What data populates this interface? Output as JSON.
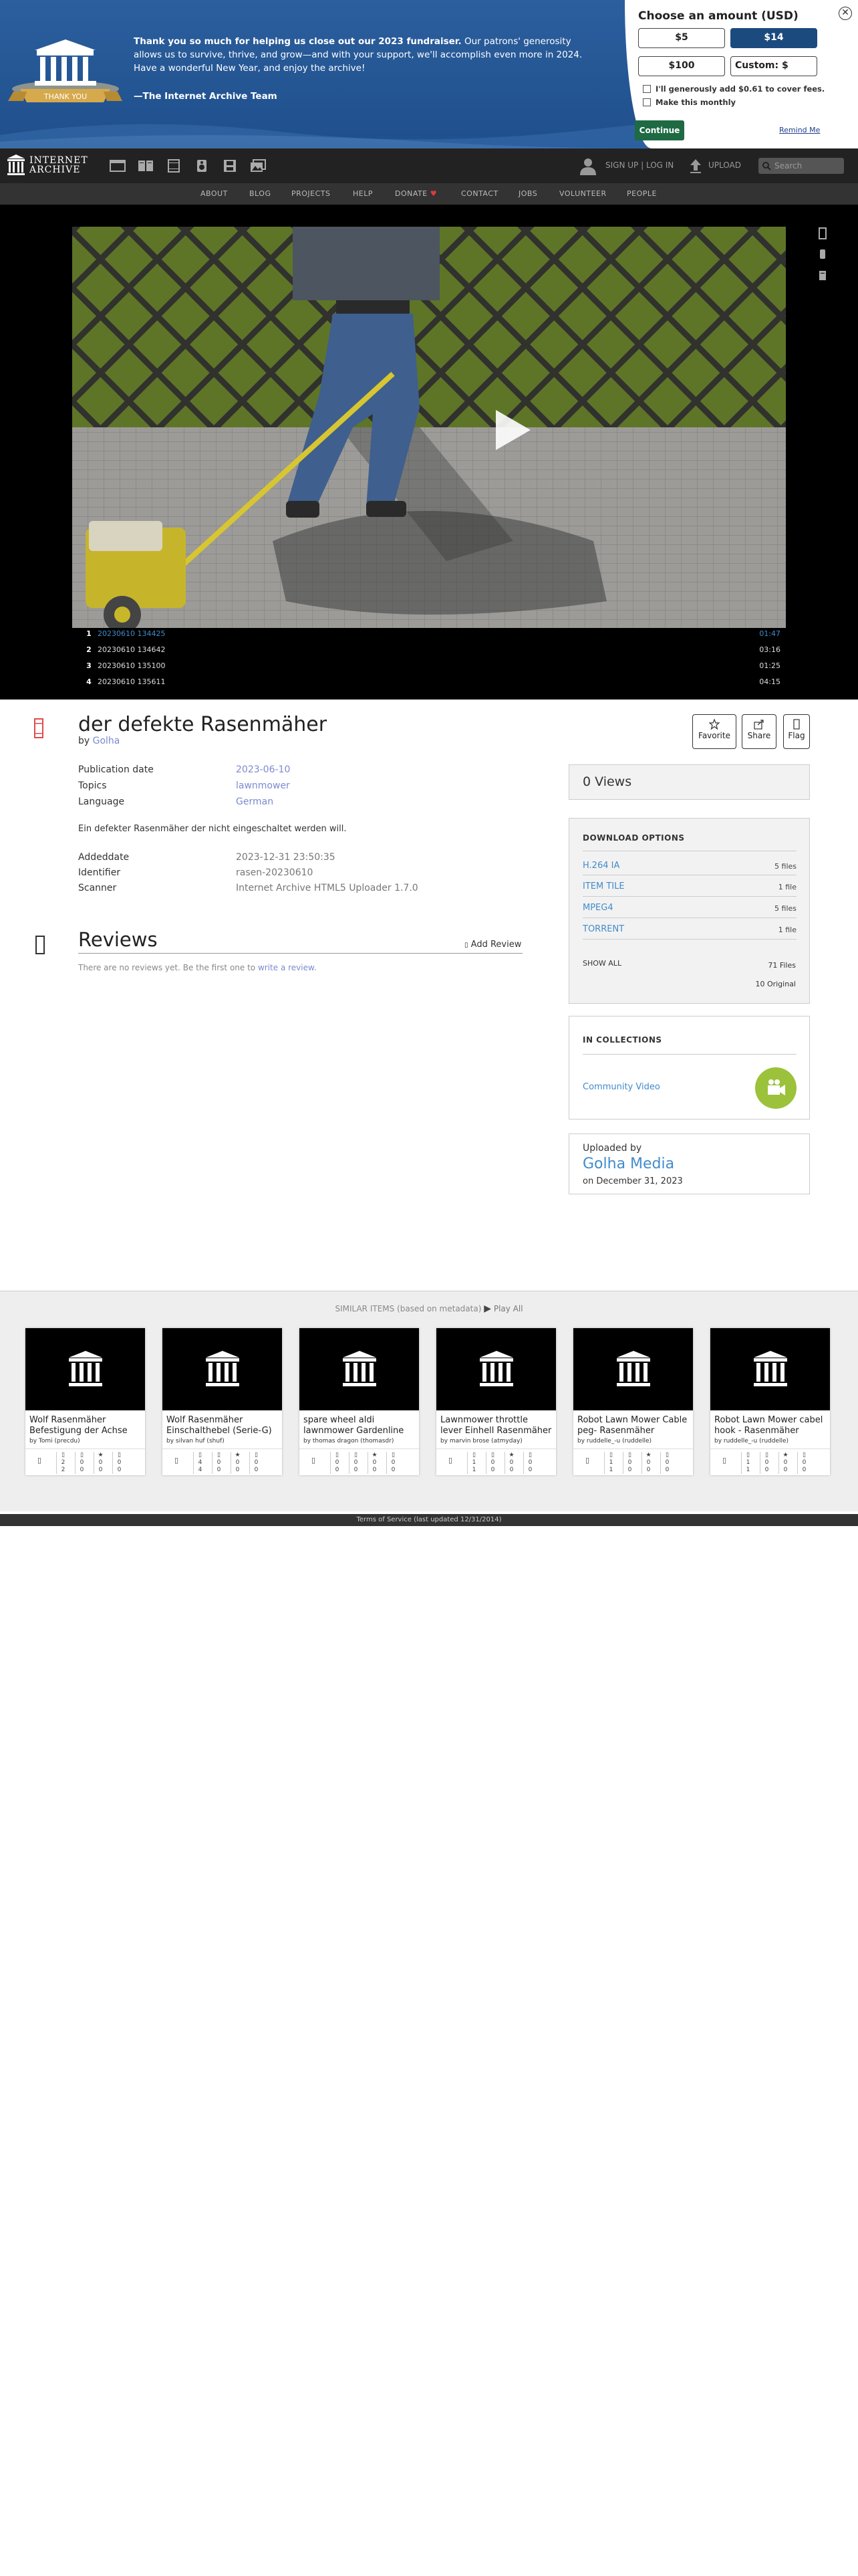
{
  "banner": {
    "message_bold": "Thank you so much for helping us close out our 2023 fundraiser.",
    "message_rest": " Our patrons' generosity allows us to survive, thrive, and grow—and with your support, we'll accomplish even more in 2024. Have a wonderful New Year, and enjoy the archive!",
    "signature": "—The Internet Archive Team",
    "logo_ribbon": "THANK YOU",
    "donate_title": "Choose an amount (USD)",
    "amounts": [
      "$5",
      "$14",
      "$100",
      "Custom: $"
    ],
    "selected_amount": "$14",
    "fee_label": "I'll generously add $0.61 to cover fees.",
    "monthly_label": "Make this monthly",
    "continue_label": "Continue",
    "remind_label": "Remind Me",
    "close_label": "✕"
  },
  "topnav": {
    "logo_line1": "INTERNET",
    "logo_line2": "ARCHIVE",
    "media_icons": [
      "web-icon",
      "texts-icon",
      "video-icon",
      "audio-icon",
      "software-icon",
      "images-icon"
    ],
    "signup_label": "SIGN UP | LOG IN",
    "upload_label": "UPLOAD",
    "search_placeholder": "Search"
  },
  "subnav": {
    "links": [
      "ABOUT",
      "BLOG",
      "PROJECTS",
      "HELP",
      "DONATE",
      "CONTACT",
      "JOBS",
      "VOLUNTEER",
      "PEOPLE"
    ]
  },
  "player": {
    "playlist": [
      {
        "n": "1",
        "title": "20230610 134425",
        "duration": "01:47",
        "active": true
      },
      {
        "n": "2",
        "title": "20230610 134642",
        "duration": "03:16",
        "active": false
      },
      {
        "n": "3",
        "title": "20230610 135100",
        "duration": "01:25",
        "active": false
      },
      {
        "n": "4",
        "title": "20230610 135611",
        "duration": "04:15",
        "active": false
      }
    ]
  },
  "item": {
    "title": "der defekte Rasenmäher",
    "by_label": "by",
    "creator": "Golha",
    "actions": {
      "favorite": "Favorite",
      "share": "Share",
      "flag": "Flag"
    },
    "metadata": [
      {
        "label": "Publication date",
        "value": "2023-06-10",
        "link": true
      },
      {
        "label": "Topics",
        "value": "lawnmower",
        "link": true
      },
      {
        "label": "Language",
        "value": "German",
        "link": true
      }
    ],
    "description": "Ein defekter Rasenmäher der nicht eingeschaltet werden will.",
    "metadata2": [
      {
        "label": "Addeddate",
        "value": "2023-12-31 23:50:35"
      },
      {
        "label": "Identifier",
        "value": "rasen-20230610"
      },
      {
        "label": "Scanner",
        "value": "Internet Archive HTML5 Uploader 1.7.0"
      }
    ]
  },
  "reviews": {
    "title": "Reviews",
    "add_label": "Add Review",
    "empty_text": "There are no reviews yet. Be the first one to",
    "empty_link": "write a review."
  },
  "sidebar": {
    "views": "0 Views",
    "download_title": "DOWNLOAD OPTIONS",
    "downloads": [
      {
        "format": "H.264 IA",
        "count": "5 files"
      },
      {
        "format": "ITEM TILE",
        "count": "1 file"
      },
      {
        "format": "MPEG4",
        "count": "5 files"
      },
      {
        "format": "TORRENT",
        "count": "1 file"
      }
    ],
    "show_all": "SHOW ALL",
    "total_files": "71 Files",
    "original_files": "10 Original",
    "collections_title": "IN COLLECTIONS",
    "collection": "Community Video",
    "uploaded_by_label": "Uploaded by",
    "uploader": "Golha Media",
    "upload_date": "on December 31, 2023"
  },
  "similar": {
    "header": "SIMILAR ITEMS (based on metadata)",
    "play_all": "Play All",
    "items": [
      {
        "t1": "Wolf Rasenmäher",
        "t2": "Befestigung der Achse",
        "by": "by Tomi (precdu)",
        "stats": [
          [
            "2",
            "2"
          ],
          [
            "0",
            "0"
          ],
          [
            "0",
            "0"
          ],
          [
            "0",
            "0"
          ]
        ]
      },
      {
        "t1": "Wolf Rasenmäher",
        "t2": "Einschalthebel (Serie-G)",
        "by": "by silvan huf (shuf)",
        "stats": [
          [
            "4",
            "4"
          ],
          [
            "0",
            "0"
          ],
          [
            "0",
            "0"
          ],
          [
            "0",
            "0"
          ]
        ]
      },
      {
        "t1": "spare wheel aldi",
        "t2": "lawnmower Gardenline",
        "by": "by thomas dragon (thomasdr)",
        "stats": [
          [
            "0",
            "0"
          ],
          [
            "0",
            "0"
          ],
          [
            "0",
            "0"
          ],
          [
            "0",
            "0"
          ]
        ]
      },
      {
        "t1": "Lawnmower throttle",
        "t2": "lever Einhell Rasenmäher",
        "by": "by marvin brose (atmyday)",
        "stats": [
          [
            "1",
            "1"
          ],
          [
            "0",
            "0"
          ],
          [
            "0",
            "0"
          ],
          [
            "0",
            "0"
          ]
        ]
      },
      {
        "t1": "Robot Lawn Mower Cable",
        "t2": "peg- Rasenmäher",
        "by": "by ruddelle_-u (ruddelle)",
        "stats": [
          [
            "1",
            "1"
          ],
          [
            "0",
            "0"
          ],
          [
            "0",
            "0"
          ],
          [
            "0",
            "0"
          ]
        ]
      },
      {
        "t1": "Robot Lawn Mower cabel",
        "t2": "hook - Rasenmäher",
        "by": "by ruddelle_-u (ruddelle)",
        "stats": [
          [
            "1",
            "1"
          ],
          [
            "0",
            "0"
          ],
          [
            "0",
            "0"
          ],
          [
            "0",
            "0"
          ]
        ]
      }
    ]
  },
  "footer": "Terms of Service (last updated 12/31/2014)"
}
